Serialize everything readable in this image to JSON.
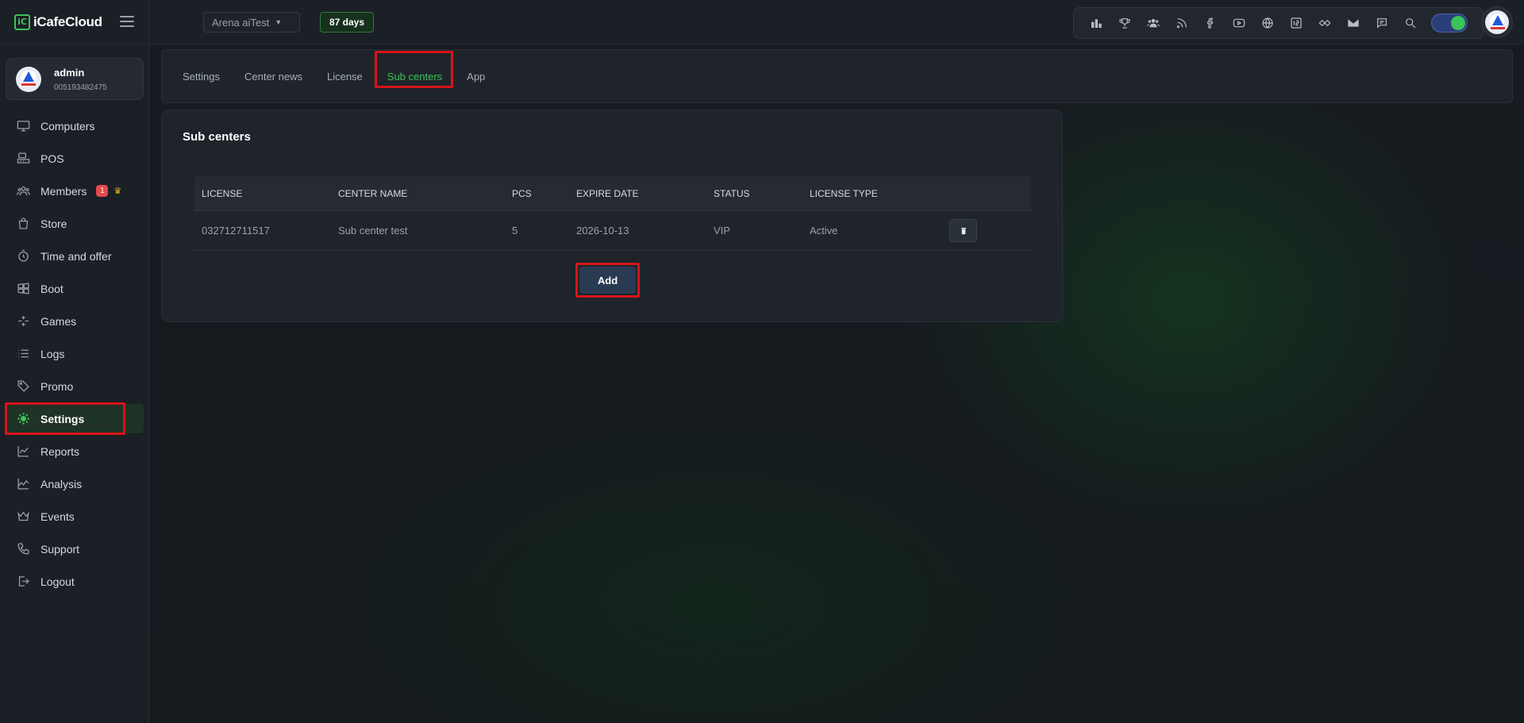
{
  "brand": {
    "name": "iCafeCloud",
    "logo_text": "iC"
  },
  "user": {
    "name": "admin",
    "id": "005193482475"
  },
  "topbar": {
    "center_select": "Arena aiTest",
    "days_left": "87 days"
  },
  "toolbar_icons": [
    "ranking-icon",
    "trophy-icon",
    "group-icon",
    "rss-icon",
    "facebook-icon",
    "youtube-icon",
    "globe-icon",
    "icafe-icon",
    "handshake-icon",
    "mail-icon",
    "chat-icon",
    "search-icon"
  ],
  "sidebar": {
    "items": [
      {
        "label": "Computers",
        "icon": "monitor-icon"
      },
      {
        "label": "POS",
        "icon": "pos-icon"
      },
      {
        "label": "Members",
        "icon": "members-icon",
        "badge": "1"
      },
      {
        "label": "Store",
        "icon": "store-icon"
      },
      {
        "label": "Time and offer",
        "icon": "timer-icon"
      },
      {
        "label": "Boot",
        "icon": "windows-icon"
      },
      {
        "label": "Games",
        "icon": "gamepad-icon"
      },
      {
        "label": "Logs",
        "icon": "list-icon"
      },
      {
        "label": "Promo",
        "icon": "tag-icon"
      },
      {
        "label": "Settings",
        "icon": "gear-icon",
        "active": true
      },
      {
        "label": "Reports",
        "icon": "line-chart-icon"
      },
      {
        "label": "Analysis",
        "icon": "area-chart-icon"
      },
      {
        "label": "Events",
        "icon": "crown-icon"
      },
      {
        "label": "Support",
        "icon": "phone-icon"
      },
      {
        "label": "Logout",
        "icon": "logout-icon"
      }
    ]
  },
  "tabs": [
    {
      "label": "Settings"
    },
    {
      "label": "Center news"
    },
    {
      "label": "License"
    },
    {
      "label": "Sub centers",
      "active": true
    },
    {
      "label": "App"
    }
  ],
  "panel": {
    "title": "Sub centers",
    "columns": [
      "LICENSE",
      "CENTER NAME",
      "PCS",
      "EXPIRE DATE",
      "STATUS",
      "LICENSE TYPE"
    ],
    "rows": [
      {
        "license": "032712711517",
        "center_name": "Sub center test",
        "pcs": "5",
        "expire_date": "2026-10-13",
        "status": "VIP",
        "license_type": "Active"
      }
    ],
    "add_label": "Add"
  },
  "colors": {
    "accent": "#3cc25a",
    "highlight": "#d7141a",
    "badge": "#e5484d",
    "background": "#161a20"
  }
}
